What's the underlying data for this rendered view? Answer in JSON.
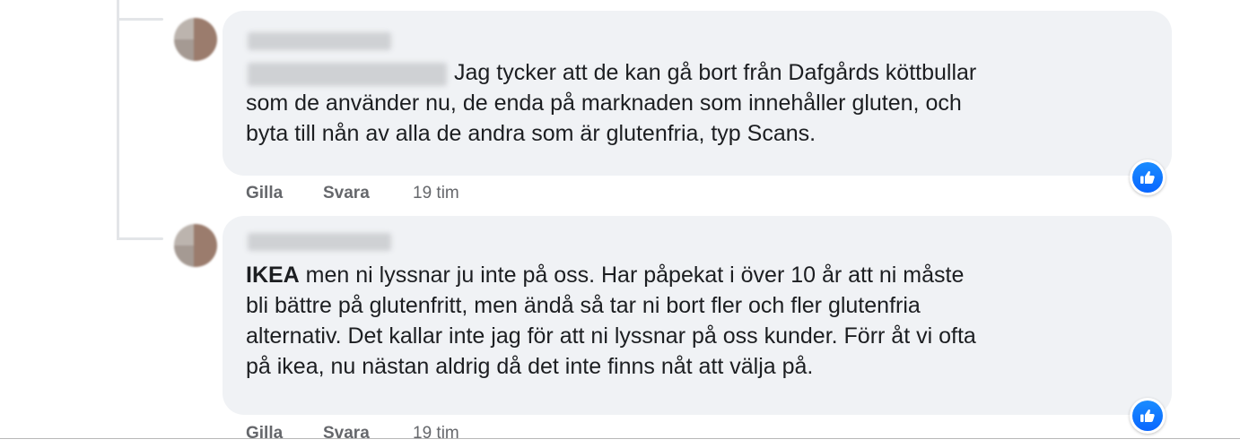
{
  "comments": [
    {
      "text": "Jag tycker att de kan gå bort från Dafgårds köttbullar\nsom de använder nu, de enda på marknaden som innehåller gluten, och\nbyta till nån av alla de andra som är glutenfria, typ Scans.",
      "actions": {
        "like_label": "Gilla",
        "reply_label": "Svara",
        "time": "19 tim"
      },
      "reaction_icon": "like-reaction-icon"
    },
    {
      "mention": "IKEA",
      "text": " men ni lyssnar ju inte på oss. Har påpekat i över 10 år att ni måste\nbli bättre på glutenfritt, men ändå så tar ni bort fler och fler glutenfria\nalternativ. Det kallar inte jag för att ni lyssnar på oss kunder. Förr åt vi ofta\npå ikea, nu nästan aldrig då det inte finns nåt att välja på.",
      "actions": {
        "like_label": "Gilla",
        "reply_label": "Svara",
        "time": "19 tim"
      },
      "reaction_icon": "like-reaction-icon"
    }
  ],
  "colors": {
    "bubble": "#f0f2f5",
    "text": "#1c1e21",
    "secondary_text": "#65676b",
    "like_blue": "#0966ff"
  }
}
